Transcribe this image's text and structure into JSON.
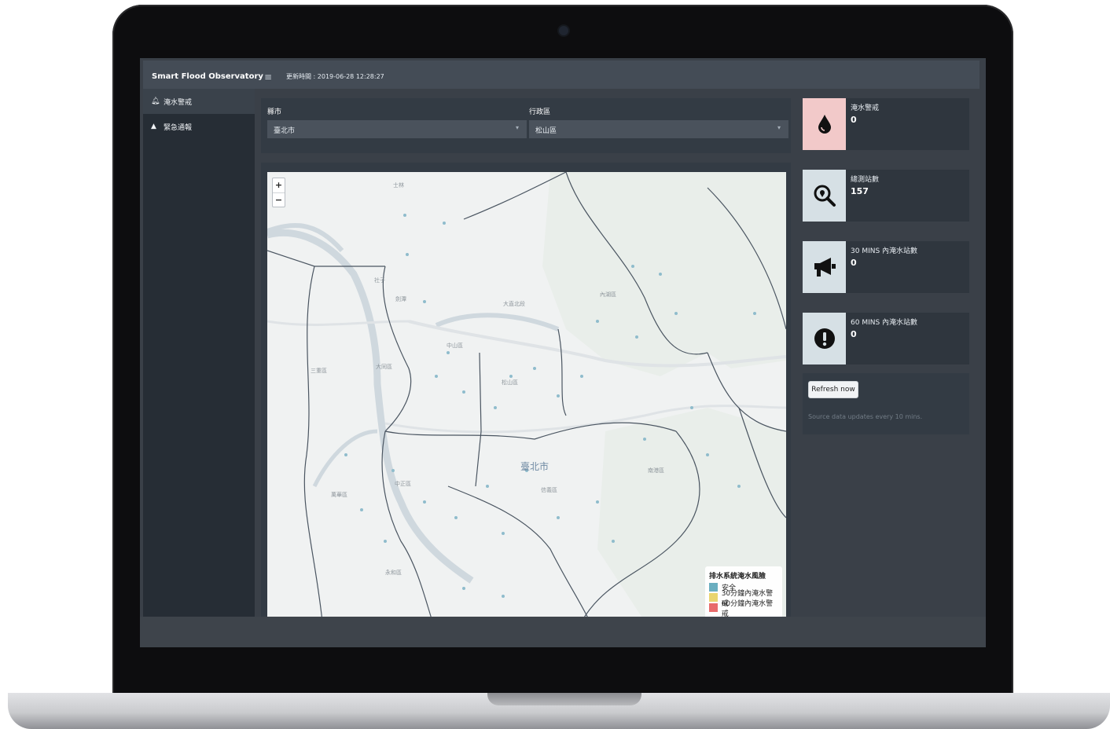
{
  "app": {
    "brand": "Smart Flood Observatory",
    "updated": "更新時間 : 2019-06-28 12:28:27"
  },
  "sidebar": {
    "items": [
      {
        "label": "淹水警戒",
        "icon": "bell-icon",
        "active": true
      },
      {
        "label": "緊急通報",
        "icon": "warning-triangle-icon",
        "active": false
      }
    ]
  },
  "filters": {
    "county_label": "縣市",
    "county_value": "臺北市",
    "district_label": "行政區",
    "district_value": "松山區"
  },
  "map": {
    "zoom_in": "+",
    "zoom_out": "−",
    "labels": {
      "taipei": "臺北市",
      "songshan": "松山區",
      "zhongshan": "中山區",
      "datong": "大同區",
      "zhongzheng": "中正區",
      "wanhua": "萬華區",
      "xinyi": "信義區",
      "nangang": "南港區",
      "neihu": "內湖區",
      "sanchong": "三重區",
      "yonghe": "永和區",
      "shilin": "士林",
      "dazhi": "大直北段",
      "jiannan": "劍潭",
      "shetsz": "社子"
    },
    "legend": {
      "title": "排水系統淹水風險",
      "items": [
        {
          "label": "安全",
          "color": "#6aaec0"
        },
        {
          "label": "30分鐘內淹水警戒",
          "color": "#e9d56f"
        },
        {
          "label": "60分鐘內淹水警戒",
          "color": "#e86b6b"
        }
      ]
    }
  },
  "cards": [
    {
      "title": "淹水警戒",
      "value": "0",
      "icon": "water-drop-icon",
      "bg": "#f2c9c9"
    },
    {
      "title": "總測站數",
      "value": "157",
      "icon": "search-location-icon",
      "bg": "#d6e0e5"
    },
    {
      "title": "30 MINS 內淹水站數",
      "value": "0",
      "icon": "megaphone-icon",
      "bg": "#d6e0e5"
    },
    {
      "title": "60 MINS 內淹水站數",
      "value": "0",
      "icon": "exclamation-circle-icon",
      "bg": "#d6e0e5"
    }
  ],
  "refresh": {
    "button_label": "Refresh now",
    "note": "Source data updates every 10 mins."
  }
}
